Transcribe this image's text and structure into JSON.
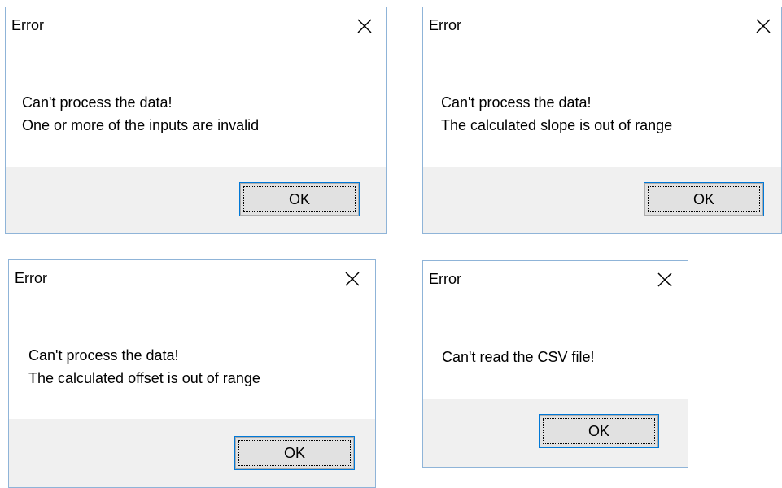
{
  "dialogs": [
    {
      "title": "Error",
      "message_line1": "Can't process the data!",
      "message_line2": "One or more of the inputs are invalid",
      "ok_label": "OK"
    },
    {
      "title": "Error",
      "message_line1": "Can't process the data!",
      "message_line2": "The calculated slope is out of range",
      "ok_label": "OK"
    },
    {
      "title": "Error",
      "message_line1": "Can't process the data!",
      "message_line2": "The calculated offset is out of range",
      "ok_label": "OK"
    },
    {
      "title": "Error",
      "message_line1": "Can't read the CSV file!",
      "ok_label": "OK"
    }
  ],
  "icons": {
    "close": "close-icon"
  },
  "colors": {
    "window_border": "#8fb4d8",
    "footer_background": "#f0f0f0",
    "button_face": "#e1e1e1",
    "button_focus_border": "#0078d7"
  }
}
